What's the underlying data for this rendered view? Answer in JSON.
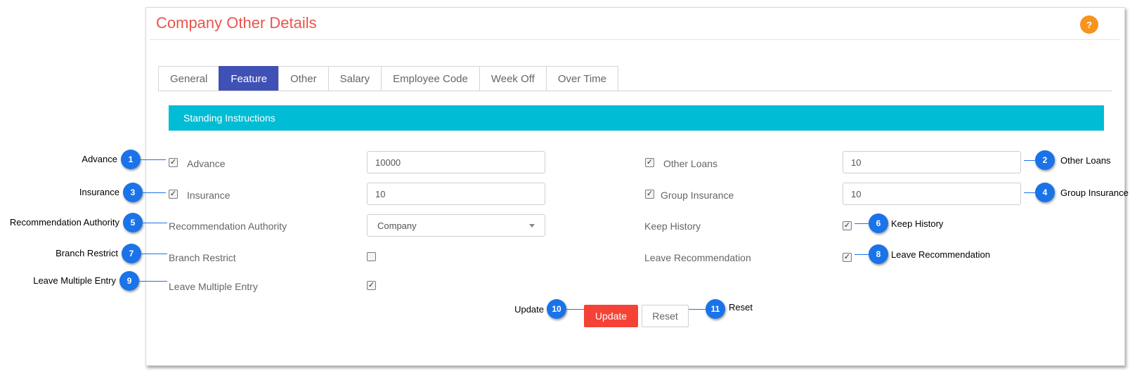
{
  "page": {
    "title": "Company Other Details",
    "help_label": "?"
  },
  "tabs": [
    "General",
    "Feature",
    "Other",
    "Salary",
    "Employee Code",
    "Week Off",
    "Over Time"
  ],
  "active_tab": "Feature",
  "section": {
    "title": "Standing Instructions"
  },
  "form": {
    "advance": {
      "label": "Advance",
      "checked": true,
      "value": "10000"
    },
    "insurance": {
      "label": "Insurance",
      "checked": true,
      "value": "10"
    },
    "recommendation_authority": {
      "label": "Recommendation Authority",
      "value": "Company"
    },
    "branch_restrict": {
      "label": "Branch Restrict",
      "checked": false
    },
    "leave_multiple_entry": {
      "label": "Leave Multiple Entry",
      "checked": true
    },
    "other_loans": {
      "label": "Other Loans",
      "checked": true,
      "value": "10"
    },
    "group_insurance": {
      "label": "Group Insurance",
      "checked": true,
      "value": "10"
    },
    "keep_history": {
      "label": "Keep History",
      "checked": true
    },
    "leave_recommendation": {
      "label": "Leave Recommendation",
      "checked": true
    }
  },
  "buttons": {
    "update": "Update",
    "reset": "Reset"
  },
  "callouts": [
    {
      "number": "1",
      "label": "Advance"
    },
    {
      "number": "2",
      "label": "Other Loans"
    },
    {
      "number": "3",
      "label": "Insurance"
    },
    {
      "number": "4",
      "label": "Group Insurance"
    },
    {
      "number": "5",
      "label": "Recommendation Authority"
    },
    {
      "number": "6",
      "label": "Keep History"
    },
    {
      "number": "7",
      "label": "Branch Restrict"
    },
    {
      "number": "8",
      "label": "Leave Recommendation"
    },
    {
      "number": "9",
      "label": "Leave Multiple Entry"
    },
    {
      "number": "10",
      "label": "Update"
    },
    {
      "number": "11",
      "label": "Reset"
    }
  ],
  "colors": {
    "accent": "#3f51b5",
    "section": "#00bcd4",
    "title": "#e8554e",
    "update": "#f44336",
    "callout": "#1a73e8",
    "help": "#f7941d"
  }
}
